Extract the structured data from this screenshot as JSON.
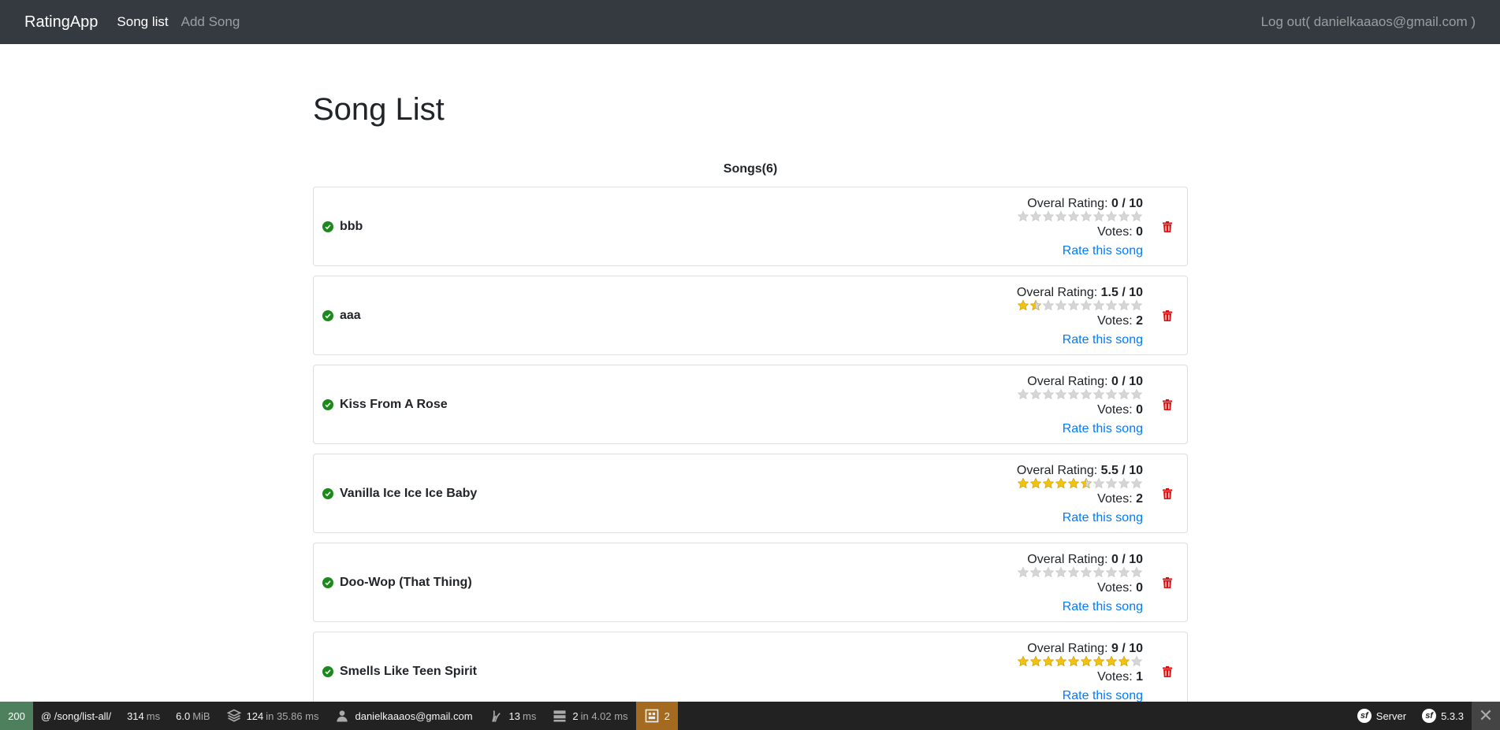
{
  "navbar": {
    "brand": "RatingApp",
    "links": [
      {
        "label": "Song list",
        "active": true
      },
      {
        "label": "Add Song",
        "active": false
      }
    ],
    "logout": "Log out( danielkaaaos@gmail.com )"
  },
  "page": {
    "title": "Song List",
    "count_label": "Songs(6)"
  },
  "labels": {
    "rating": "Overal Rating: ",
    "votes": "Votes: ",
    "rate_link": "Rate this song"
  },
  "songs": [
    {
      "title": "bbb",
      "rating": "0 / 10",
      "rating_value": 0,
      "votes": "0"
    },
    {
      "title": "aaa",
      "rating": "1.5 / 10",
      "rating_value": 1.5,
      "votes": "2"
    },
    {
      "title": "Kiss From A Rose",
      "rating": "0 / 10",
      "rating_value": 0,
      "votes": "0"
    },
    {
      "title": "Vanilla Ice Ice Ice Baby",
      "rating": "5.5 / 10",
      "rating_value": 5.5,
      "votes": "2"
    },
    {
      "title": "Doo-Wop (That Thing)",
      "rating": "0 / 10",
      "rating_value": 0,
      "votes": "0"
    },
    {
      "title": "Smells Like Teen Spirit",
      "rating": "9 / 10",
      "rating_value": 9,
      "votes": "1"
    }
  ],
  "colors": {
    "star_on": "#f4c20d",
    "star_off": "#d5d5d5",
    "check": "#1a8a1a",
    "trash": "#dc1010",
    "link": "#007bff"
  },
  "toolbar": {
    "status": "200",
    "route": "@ /song/list-all/",
    "time": "314",
    "time_unit": "ms",
    "memory": "6.0",
    "memory_unit": "MiB",
    "queries": "124",
    "queries_time": "in 35.86 ms",
    "user": "danielkaaaos@gmail.com",
    "twig_time": "13",
    "twig_unit": "ms",
    "cache": "2",
    "cache_time": "in 4.02 ms",
    "forms": "2",
    "server": "Server",
    "version": "5.3.3",
    "close": "✕"
  }
}
